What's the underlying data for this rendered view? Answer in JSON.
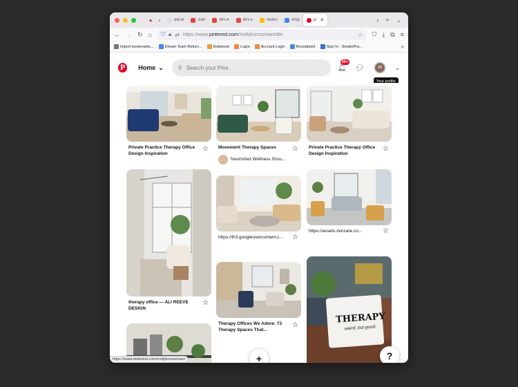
{
  "browser": {
    "tabs": [
      {
        "label": "ailLet",
        "color": "#ddd"
      },
      {
        "label": "Join",
        "color": "#e2453f"
      },
      {
        "label": "BH-A",
        "color": "#e2453f"
      },
      {
        "label": "BH-A",
        "color": "#e2453f"
      },
      {
        "label": "Notes",
        "color": "#fbbc04"
      },
      {
        "label": "Amy",
        "color": "#4285f4"
      },
      {
        "label": "pi",
        "color": "#e60023"
      }
    ],
    "url_prefix": "https://www.",
    "url_domain": "pinterest.com",
    "url_rest": "/mollykcrossman/dbt-",
    "bookmarks": [
      {
        "label": "Import bookmarks...",
        "color": "#777"
      },
      {
        "label": "Dream Team Return...",
        "color": "#4285f4"
      },
      {
        "label": "Notebook",
        "color": "#e8a23c"
      },
      {
        "label": "Login",
        "color": "#f0883e"
      },
      {
        "label": "Account Login",
        "color": "#f0883e"
      },
      {
        "label": "Roundpoint",
        "color": "#4a8ad4"
      },
      {
        "label": "Sign In - SimplePra...",
        "color": "#3b6fd1"
      }
    ]
  },
  "header": {
    "home_label": "Home",
    "search_placeholder": "Search your Pins",
    "notif_badge": "99+",
    "avatar_initial": "M",
    "tooltip": "Your profile"
  },
  "pins": [
    {
      "title": "Private Practice Therapy Office Design Inspiration",
      "source": "",
      "author": ""
    },
    {
      "title": "Movement Therapy Spaces",
      "source": "",
      "author": "Nourished Wellness Grou..."
    },
    {
      "title": "Private Practice Therapy Office Design Inspiration",
      "source": "",
      "author": ""
    },
    {
      "title": "therapy office — ALI REEVE DESIGN",
      "source": "",
      "author": ""
    },
    {
      "title": "",
      "source": "https://lh3.googleusercontent.c...",
      "author": ""
    },
    {
      "title": "",
      "source": "https://assets.zencare.co...",
      "author": ""
    },
    {
      "title": "Therapy Offices We Adore: 73 Therapy Spaces That...",
      "source": "",
      "author": ""
    },
    {
      "title": "",
      "source": "",
      "author": ""
    },
    {
      "title": "",
      "source": "",
      "author": ""
    }
  ],
  "pillow_text_1": "THERAPY",
  "pillow_text_2": "weird, but good.",
  "fab_add": "+",
  "fab_help": "?",
  "status_url": "https://www.pinterest.com/mollykcrossman/"
}
